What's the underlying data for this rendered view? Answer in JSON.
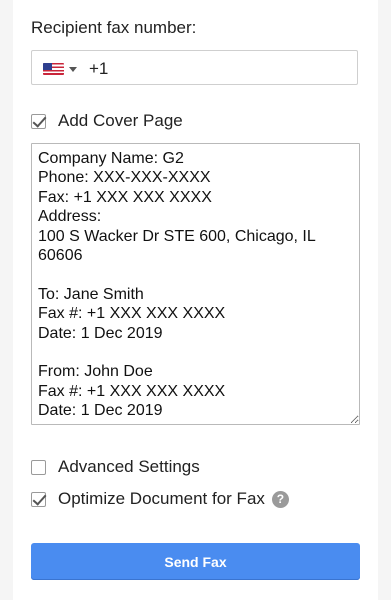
{
  "recipient": {
    "label": "Recipient fax number:",
    "country_flag": "us-flag-icon",
    "dial_code": "+1"
  },
  "cover_page": {
    "label": "Add Cover Page",
    "checked": true,
    "text": "Company Name: G2\nPhone: XXX-XXX-XXXX\nFax: +1 XXX XXX XXXX\nAddress:\n100 S Wacker Dr STE 600, Chicago, IL 60606\n\nTo: Jane Smith\nFax #: +1 XXX XXX XXXX\nDate: 1 Dec 2019\n\nFrom: John Doe\nFax #: +1 XXX XXX XXXX\nDate: 1 Dec 2019"
  },
  "advanced_settings": {
    "label": "Advanced Settings",
    "checked": false
  },
  "optimize": {
    "label": "Optimize Document for Fax",
    "checked": true,
    "help_icon": "?"
  },
  "send_button": {
    "label": "Send Fax",
    "color": "#4a8cf0"
  }
}
